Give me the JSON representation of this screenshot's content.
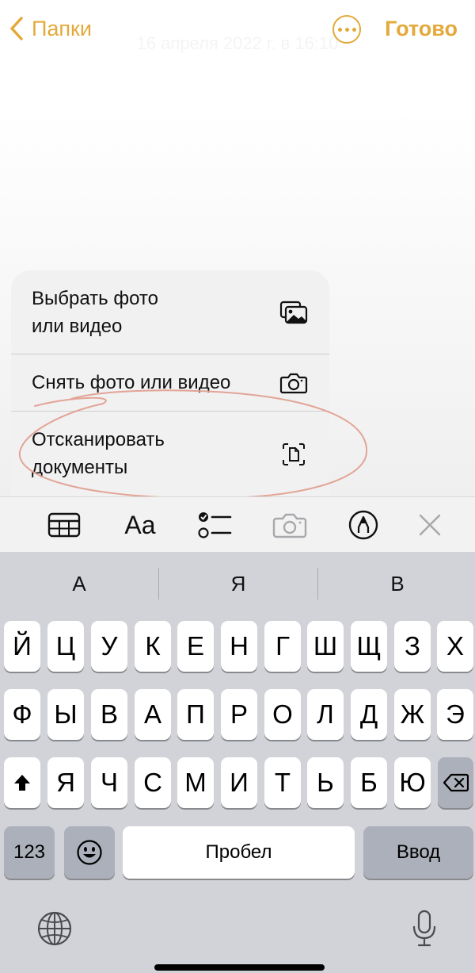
{
  "nav": {
    "back_label": "Папки",
    "done_label": "Готово",
    "more_icon": "ellipsis-circle-icon",
    "back_icon": "chevron-left-icon"
  },
  "note": {
    "date": "16 апреля 2022 г. в 16:10"
  },
  "menu": {
    "items": [
      {
        "label": "Выбрать фото\nили видео",
        "icon": "photo-library-icon"
      },
      {
        "label": "Снять фото или видео",
        "icon": "camera-icon"
      },
      {
        "label": "Отсканировать\nдокументы",
        "icon": "document-scan-icon"
      }
    ]
  },
  "toolbar": {
    "table_icon": "table-icon",
    "format_label": "Aa",
    "checklist_icon": "checklist-icon",
    "camera_icon": "camera-icon",
    "markup_icon": "markup-pen-icon",
    "close_icon": "close-icon"
  },
  "keyboard": {
    "suggestions": [
      "А",
      "Я",
      "В"
    ],
    "row1": [
      "Й",
      "Ц",
      "У",
      "К",
      "Е",
      "Н",
      "Г",
      "Ш",
      "Щ",
      "З",
      "Х"
    ],
    "row2": [
      "Ф",
      "Ы",
      "В",
      "А",
      "П",
      "Р",
      "О",
      "Л",
      "Д",
      "Ж",
      "Э"
    ],
    "row3": [
      "Я",
      "Ч",
      "С",
      "М",
      "И",
      "Т",
      "Ь",
      "Б",
      "Ю"
    ],
    "numbers_label": "123",
    "space_label": "Пробел",
    "return_label": "Ввод",
    "shift_icon": "shift-icon",
    "delete_icon": "delete-backspace-icon",
    "emoji_icon": "emoji-icon",
    "globe_icon": "globe-icon",
    "mic_icon": "microphone-icon"
  },
  "colors": {
    "accent": "#e3a93a",
    "annotation": "#e2a496",
    "keyboard_bg": "#d1d3d9",
    "key_bg": "#ffffff",
    "function_key_bg": "#abb0ba"
  }
}
